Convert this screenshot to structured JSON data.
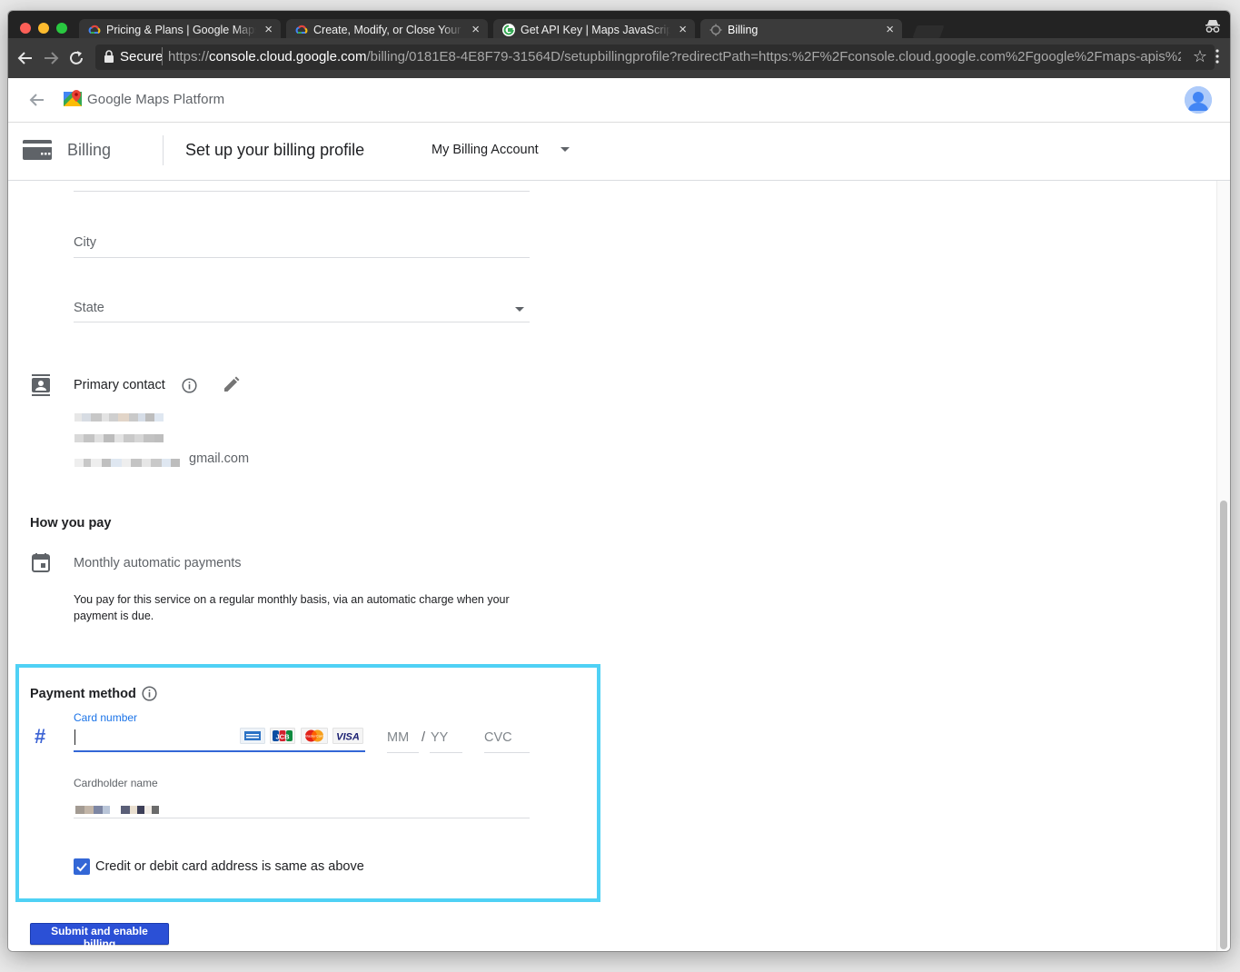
{
  "browser": {
    "tabs": [
      {
        "title": "Pricing & Plans | Google Maps",
        "favicon": "google-cloud-icon"
      },
      {
        "title": "Create, Modify, or Close Your Billing",
        "favicon": "google-cloud-icon"
      },
      {
        "title": "Get API Key  |  Maps JavaScript",
        "favicon": "google-g-icon"
      },
      {
        "title": "Billing",
        "favicon": "loading-icon",
        "active": true
      }
    ],
    "close_glyph": "×",
    "secure_label": "Secure",
    "url_scheme": "https://",
    "url_host": "console.cloud.google.com",
    "url_path": "/billing/0181E8-4E8F79-31564D/setupbillingprofile?redirectPath=https:%2F%2Fconsole.cloud.google.com%2Fgoogle%2Fmaps-apis%2..."
  },
  "app": {
    "brand_google": "Google",
    "brand_product": "Maps Platform"
  },
  "subheader": {
    "section": "Billing",
    "page_title": "Set up your billing profile",
    "account": "My Billing Account"
  },
  "address": {
    "city_label": "City",
    "state_label": "State"
  },
  "contact": {
    "title": "Primary contact",
    "email_suffix": "gmail.com"
  },
  "how_you_pay": {
    "heading": "How you pay",
    "method": "Monthly automatic payments",
    "description": "You pay for this service on a regular monthly basis, via an automatic charge when your payment is due."
  },
  "payment_method": {
    "heading": "Payment method",
    "card_number_label": "Card number",
    "card_number_value": "",
    "card_brands": [
      "AMEX",
      "JCB",
      "MasterCard",
      "VISA"
    ],
    "mm_placeholder": "MM",
    "separator": "/",
    "yy_placeholder": "YY",
    "cvc_placeholder": "CVC",
    "cardholder_label": "Cardholder name",
    "same_address_label": "Credit or debit card address is same as above",
    "same_address_checked": true
  },
  "actions": {
    "submit_label": "Submit and enable billing"
  },
  "colors": {
    "accent": "#3367d6",
    "highlight": "#4fd1f5",
    "button": "#2b50d6"
  }
}
